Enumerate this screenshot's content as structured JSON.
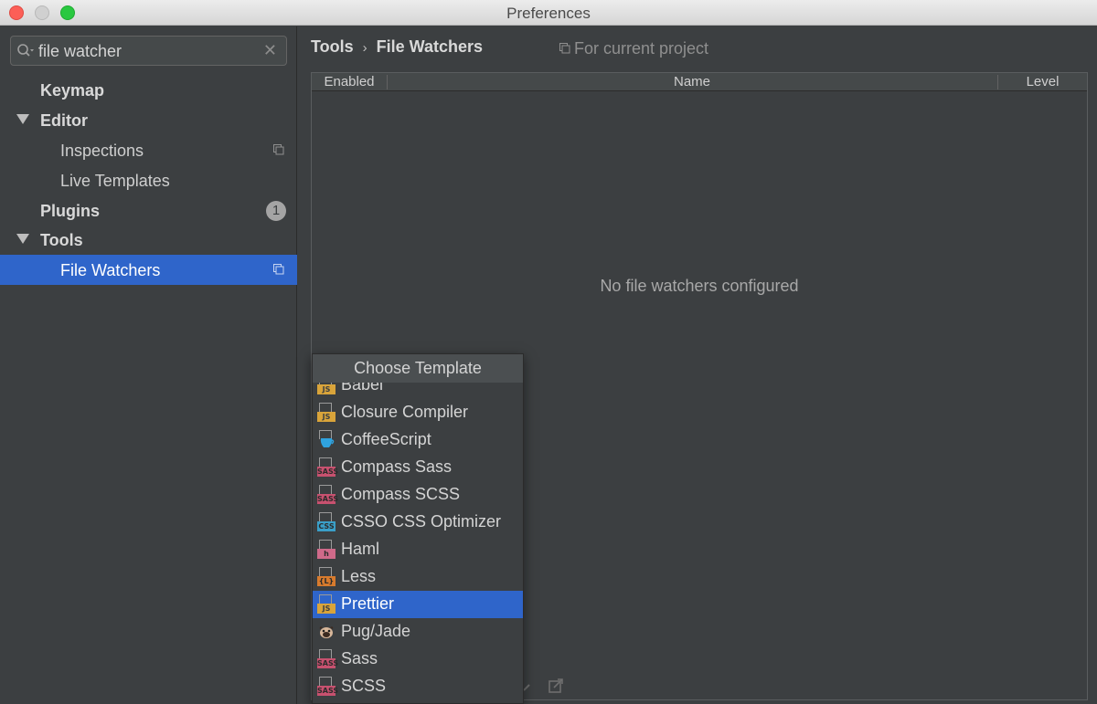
{
  "window": {
    "title": "Preferences"
  },
  "search": {
    "value": "file watcher",
    "clear_glyph": "✕"
  },
  "sidebar": {
    "items": [
      {
        "label": "Keymap"
      },
      {
        "label": "Editor"
      },
      {
        "label": "Inspections"
      },
      {
        "label": "Live Templates"
      },
      {
        "label": "Plugins",
        "badge": "1"
      },
      {
        "label": "Tools"
      },
      {
        "label": "File Watchers"
      }
    ]
  },
  "main": {
    "breadcrumb": {
      "root": "Tools",
      "separator": "›",
      "current": "File Watchers"
    },
    "scope": "For current project",
    "table": {
      "columns": [
        "Enabled",
        "Name",
        "Level"
      ],
      "empty_text": "No file watchers configured"
    }
  },
  "popup": {
    "title": "Choose Template",
    "items": [
      {
        "label": "Babel",
        "icon": "js-file-icon",
        "tag": "JS"
      },
      {
        "label": "Closure Compiler",
        "icon": "js-file-icon",
        "tag": "JS"
      },
      {
        "label": "CoffeeScript",
        "icon": "coffeescript-file-icon",
        "tag": ""
      },
      {
        "label": "Compass Sass",
        "icon": "sass-file-icon",
        "tag": "SASS"
      },
      {
        "label": "Compass SCSS",
        "icon": "sass-file-icon",
        "tag": "SASS"
      },
      {
        "label": "CSSO CSS Optimizer",
        "icon": "css-file-icon",
        "tag": "CSS"
      },
      {
        "label": "Haml",
        "icon": "haml-file-icon",
        "tag": "h"
      },
      {
        "label": "Less",
        "icon": "less-file-icon",
        "tag": "{L}"
      },
      {
        "label": "Prettier",
        "icon": "js-file-icon",
        "tag": "JS"
      },
      {
        "label": "Pug/Jade",
        "icon": "pug-icon",
        "tag": ""
      },
      {
        "label": "Sass",
        "icon": "sass-file-icon",
        "tag": "SASS"
      },
      {
        "label": "SCSS",
        "icon": "sass-file-icon",
        "tag": "SASS"
      }
    ],
    "selected": "Prettier"
  },
  "colors": {
    "accent": "#2f65ca",
    "background": "#3c3f41",
    "js_tag": "#d9a43a",
    "sass_tag": "#c7516f",
    "css_tag": "#3a9fc8",
    "haml_tag": "#cf6a8a",
    "less_tag": "#d87b2d"
  }
}
